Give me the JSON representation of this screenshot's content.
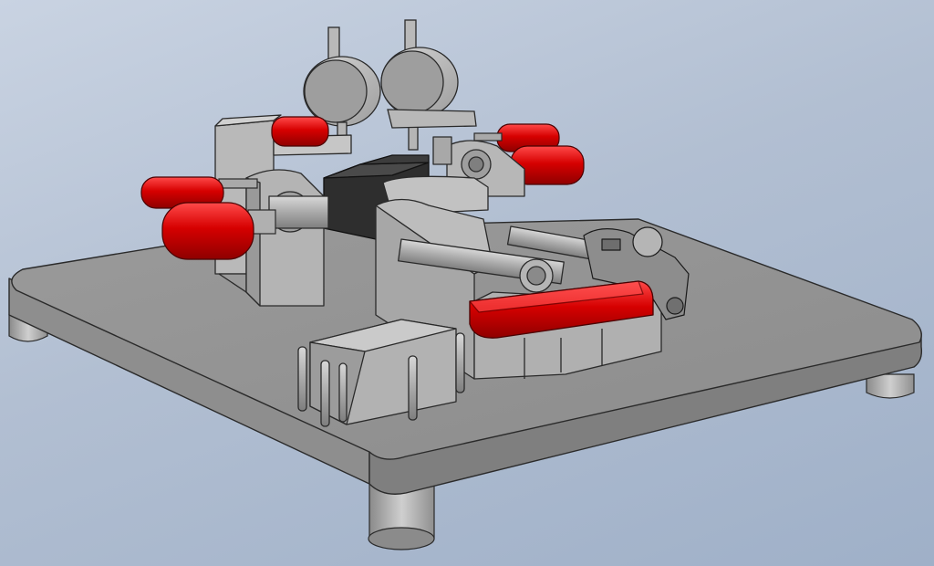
{
  "scene": {
    "title": "",
    "palette": {
      "background_top": "#c9d3e2",
      "background_bottom": "#9fb0c8",
      "steel_light": "#c4c4c4",
      "steel_mid": "#a8a8a8",
      "steel_dark": "#8a8a8a",
      "edge": "#2a2a2a",
      "handle_red": "#d80000",
      "handle_red_dark": "#9a0000",
      "block_black": "#2b2b2b"
    },
    "components": [
      "base-plate",
      "support-feet",
      "dial-indicators",
      "clamp-blocks",
      "red-handles",
      "toggle-clamp",
      "pin-block",
      "guide-rods"
    ]
  }
}
